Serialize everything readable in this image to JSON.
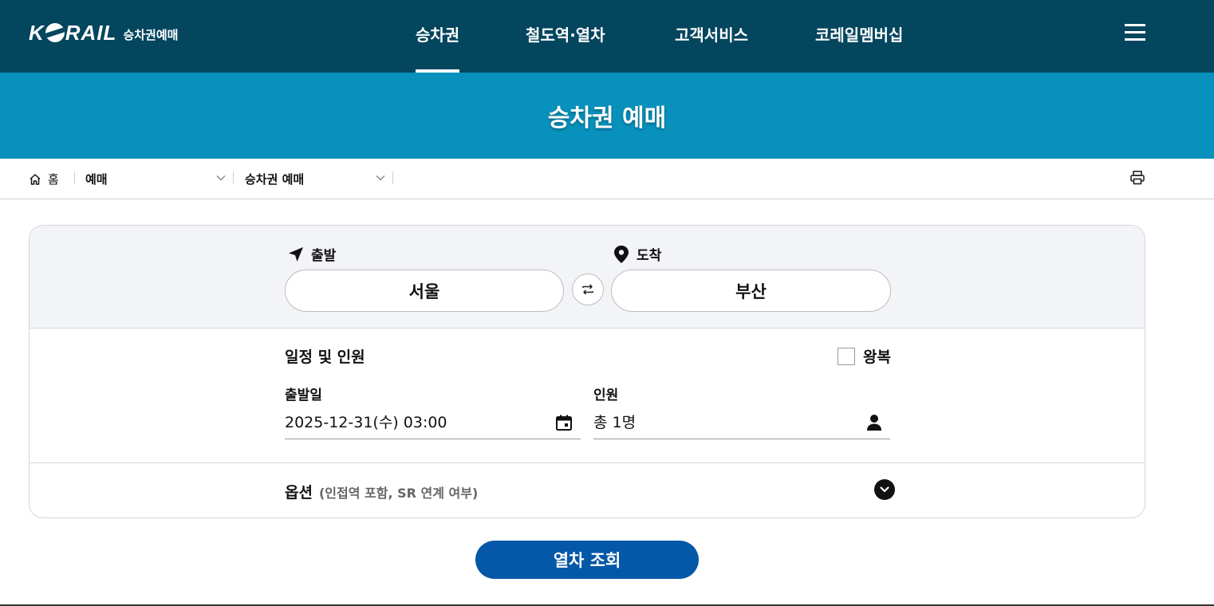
{
  "header": {
    "logo_text_left": "K",
    "logo_text_right": "RAIL",
    "logo_subtitle": "승차권예매",
    "nav": [
      {
        "label": "승차권",
        "active": true
      },
      {
        "label": "철도역·열차",
        "active": false
      },
      {
        "label": "고객서비스",
        "active": false
      },
      {
        "label": "코레일멤버십",
        "active": false
      }
    ],
    "menu_icon": "hamburger-icon"
  },
  "page_title": "승차권 예매",
  "breadcrumb": {
    "home_label": "홈",
    "level1": "예매",
    "level2": "승차권 예매",
    "print_icon": "printer-icon"
  },
  "booking": {
    "departure_label": "출발",
    "departure_station": "서울",
    "arrival_label": "도착",
    "arrival_station": "부산",
    "schedule_title": "일정 및 인원",
    "roundtrip_label": "왕복",
    "roundtrip_checked": false,
    "date_label": "출발일",
    "date_value": "2025-12-31(수) 03:00",
    "passenger_label": "인원",
    "passenger_value": "총 1명",
    "option_title": "옵션",
    "option_subtitle": "(인접역 포함, SR 연계 여부)",
    "search_button": "열차 조회"
  },
  "colors": {
    "topbar": "#03465e",
    "titleband": "#0891bc",
    "card_top": "#f3f4f8",
    "search_button": "#0558a7"
  }
}
